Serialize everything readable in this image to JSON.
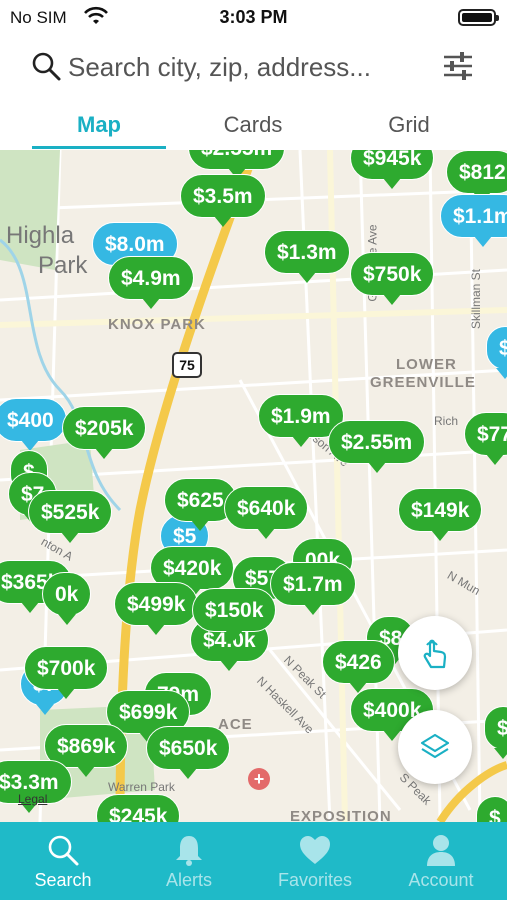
{
  "status_bar": {
    "carrier": "No SIM",
    "time": "3:03 PM"
  },
  "search": {
    "placeholder": "Search city, zip, address..."
  },
  "tabs": [
    {
      "label": "Map",
      "active": true
    },
    {
      "label": "Cards",
      "active": false
    },
    {
      "label": "Grid",
      "active": false
    }
  ],
  "map": {
    "labels": {
      "highland": "Highla",
      "park": "Park",
      "knox_park": "KNOX PARK",
      "lower": "LOWER",
      "greenville": "GREENVILLE",
      "exposition": "EXPOSITION",
      "warren_park": "Warren Park",
      "peak_st": "N Peak St",
      "haskell": "N Haskell Ave",
      "s_peak": "S Peak",
      "skillman": "Skillman St",
      "rich": "Rich",
      "ace": "ACE",
      "n_mun": "N Mun",
      "greenville_ave": "Greenville Ave",
      "henderson": "erson Ave",
      "anton": "nton A"
    },
    "highway": "75",
    "legal": "Legal",
    "pins": {
      "p945k": "$945k",
      "p812": "$812",
      "p3_5m": "$3.5m",
      "p1_1m": "$1.1m",
      "p8_0m": "$8.0m",
      "p4_9m": "$4.9m",
      "p1_3m": "$1.3m",
      "p750k": "$750k",
      "p400": "$400",
      "p205k": "$205k",
      "p1_9m": "$1.9m",
      "p2_55m": "$2.55m",
      "p77": "$77",
      "p525k": "$525k",
      "p625": "$625",
      "p640k": "$640k",
      "p149k": "$149k",
      "p365k": "$365k",
      "p420k": "$420k",
      "p1_7m": "$1.7m",
      "p499k": "$499k",
      "p150k": "$150k",
      "p700k": "$700k",
      "p79m": "79m",
      "p699k": "$699k",
      "p426": "$426",
      "p400k": "$400k",
      "p869k": "$869k",
      "p650k": "$650k",
      "p3_3m": "$3.3m",
      "p245k": "$245k",
      "p0k": "0k",
      "p8": "$8",
      "p4_0k": "$4.0k",
      "p57": "$57",
      "p00k": "00k"
    }
  },
  "bottom_nav": [
    {
      "label": "Search",
      "icon": "search-icon",
      "active": true
    },
    {
      "label": "Alerts",
      "icon": "bell-icon",
      "active": false
    },
    {
      "label": "Favorites",
      "icon": "heart-icon",
      "active": false
    },
    {
      "label": "Account",
      "icon": "person-icon",
      "active": false
    }
  ],
  "colors": {
    "accent": "#1ab0c4",
    "nav_bg": "#1fbac8",
    "pin_green": "#2eaa2f",
    "pin_blue": "#35b8e3",
    "map_bg": "#f3efe6"
  }
}
